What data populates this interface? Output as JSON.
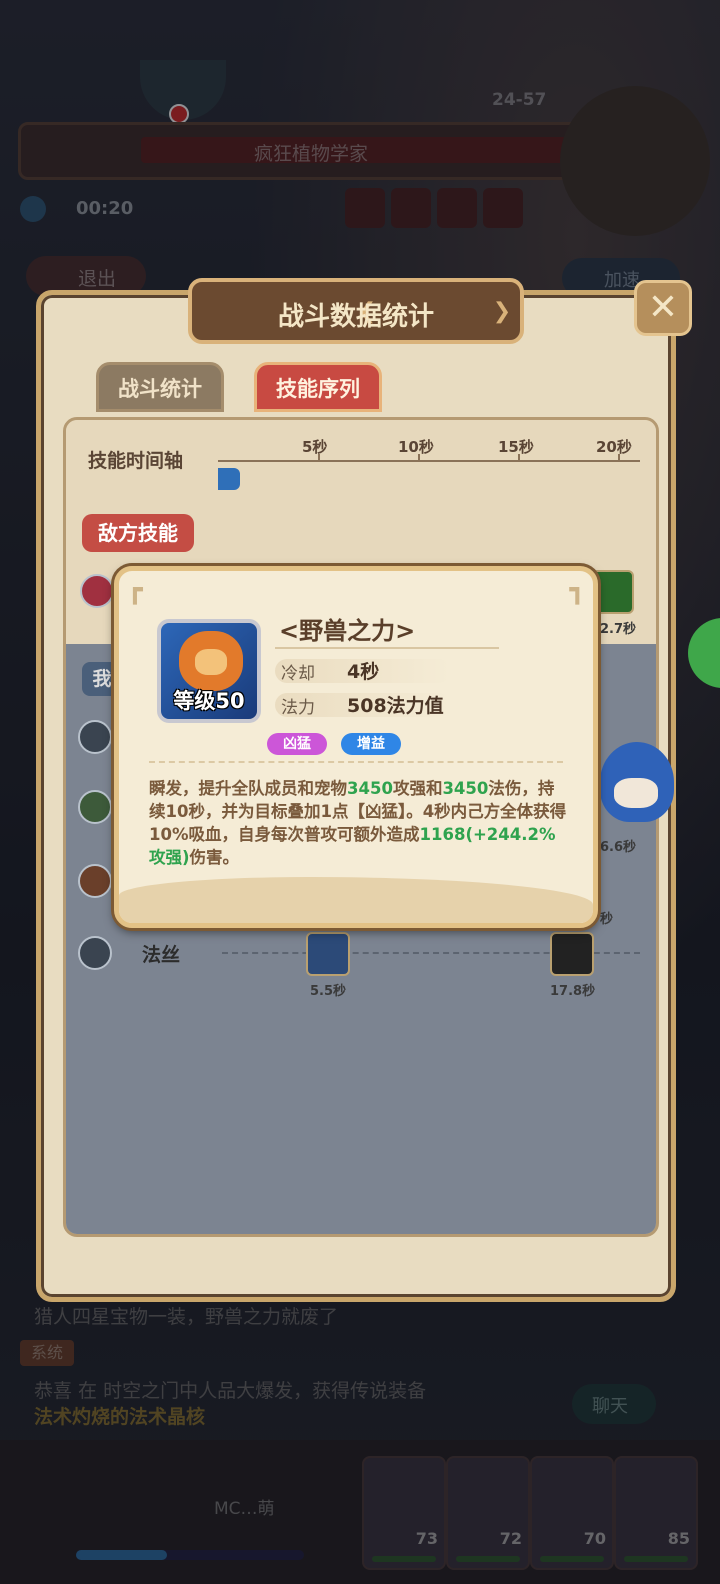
{
  "background": {
    "level_range": "24-57",
    "boss_name": "疯狂植物学家",
    "timer": "00:20",
    "exit_label": "退出",
    "speed_label": "加速",
    "chat": {
      "line1": "猎人四星宝物一装，野兽之力就废了",
      "system_tag": "系统",
      "line2": "恭喜      在 时空之门中人品大爆发，获得传说装备",
      "line3": "法术灼烧的法术晶核",
      "chat_button": "聊天"
    },
    "player_name": "MC…萌",
    "hero_levels": [
      "73",
      "72",
      "70",
      "85"
    ]
  },
  "panel": {
    "title": "战斗数据统计",
    "close_label": "✕",
    "tabs": [
      {
        "label": "战斗统计",
        "active": false
      },
      {
        "label": "技能序列",
        "active": true
      }
    ],
    "timeline": {
      "label": "技能时间轴",
      "ticks": [
        "5秒",
        "10秒",
        "15秒",
        "20秒"
      ]
    },
    "enemy_section_label": "敌方技能",
    "our_section_label": "我",
    "rows": [
      {
        "name": "法丝",
        "skill_times": [
          "5.5秒",
          "17.8秒"
        ]
      }
    ],
    "right_times": [
      "2.7秒",
      "6.6秒",
      "秒"
    ]
  },
  "tooltip": {
    "skill_name": "<野兽之力>",
    "icon_level": "等级50",
    "cooldown_label": "冷却",
    "cooldown_value": "4秒",
    "mana_label": "法力",
    "mana_value": "508法力值",
    "tags": [
      "凶猛",
      "增益"
    ],
    "desc_parts": [
      {
        "t": "瞬发，提升全队成员和宠物",
        "g": false
      },
      {
        "t": "3450",
        "g": true
      },
      {
        "t": "攻强和",
        "g": false
      },
      {
        "t": "3450",
        "g": true
      },
      {
        "t": "法伤，持续10秒，并为目标叠加1点【凶猛】。4秒内己方全体获得10%吸血，自身每次普攻可额外造成",
        "g": false
      },
      {
        "t": "1168",
        "g": true
      },
      {
        "t": "(+244.2%攻强)",
        "g": true
      },
      {
        "t": "伤害。",
        "g": false
      }
    ]
  },
  "colors": {
    "panel_bg": "#e8dcc1",
    "tab_active": "#c84a42",
    "highlight_green": "#2fa34e",
    "tag_fierce": "#cc56d8",
    "tag_buff": "#2f86e6"
  }
}
